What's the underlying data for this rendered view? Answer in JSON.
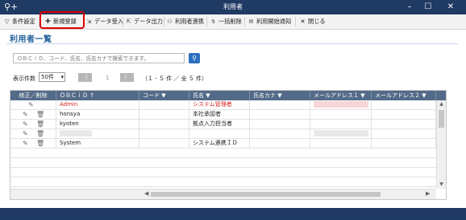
{
  "window": {
    "title": "利用者",
    "app_icon": "search-add-icon",
    "minimize": "–",
    "maximize": "☐",
    "close": "✕"
  },
  "toolbar": {
    "items": [
      {
        "label": "条件設定",
        "icon": "filter-icon"
      },
      {
        "label": "新規登録",
        "icon": "plus-icon"
      },
      {
        "label": "データ受入",
        "icon": "import-icon"
      },
      {
        "label": "データ出力",
        "icon": "export-icon"
      },
      {
        "label": "利用者連携",
        "icon": "user-link-icon"
      },
      {
        "label": "一括削除",
        "icon": "bulk-delete-icon"
      },
      {
        "label": "利用開始通知",
        "icon": "mail-notify-icon"
      },
      {
        "label": "閉じる",
        "icon": "close-icon"
      }
    ]
  },
  "page": {
    "title": "利用者一覧"
  },
  "search": {
    "placeholder": "ＯＢＣｉＤ、コード、氏名、氏名カナで検索できます。"
  },
  "pager": {
    "count_label": "表示件数",
    "count_value": "50件",
    "page_number": "1",
    "range_text": "（１ - ５ 件 ／ 全 ５ 件）",
    "prev": "〈",
    "next": "〉"
  },
  "grid": {
    "columns": [
      "修正／削除",
      "ＯＢＣｉＤ ↑",
      "コード ▼",
      "氏名 ▼",
      "氏名カナ ▼",
      "メールアドレス１ ▼",
      "メールアドレス２ ▼"
    ],
    "rows": [
      {
        "obcid": "Admin",
        "code": "",
        "name": "システム管理者",
        "kana": "",
        "mail1": "",
        "highlight": true
      },
      {
        "obcid": "honsya",
        "code": "",
        "name": "本社承認者",
        "kana": "",
        "mail1": "",
        "highlight": false
      },
      {
        "obcid": "kyoten",
        "code": "",
        "name": "拠点入力担当者",
        "kana": "",
        "mail1": "",
        "highlight": false
      },
      {
        "obcid": "",
        "code": "",
        "name": "",
        "kana": "",
        "mail1": "",
        "highlight": false
      },
      {
        "obcid": "System",
        "code": "",
        "name": "システム連携ＩＤ",
        "kana": "",
        "mail1": "",
        "highlight": false
      }
    ]
  },
  "colors": {
    "title_bar": "#1f3a63",
    "grid_header": "#536b88",
    "accent_red": "#d62020",
    "highlight_box": "#e00000"
  }
}
